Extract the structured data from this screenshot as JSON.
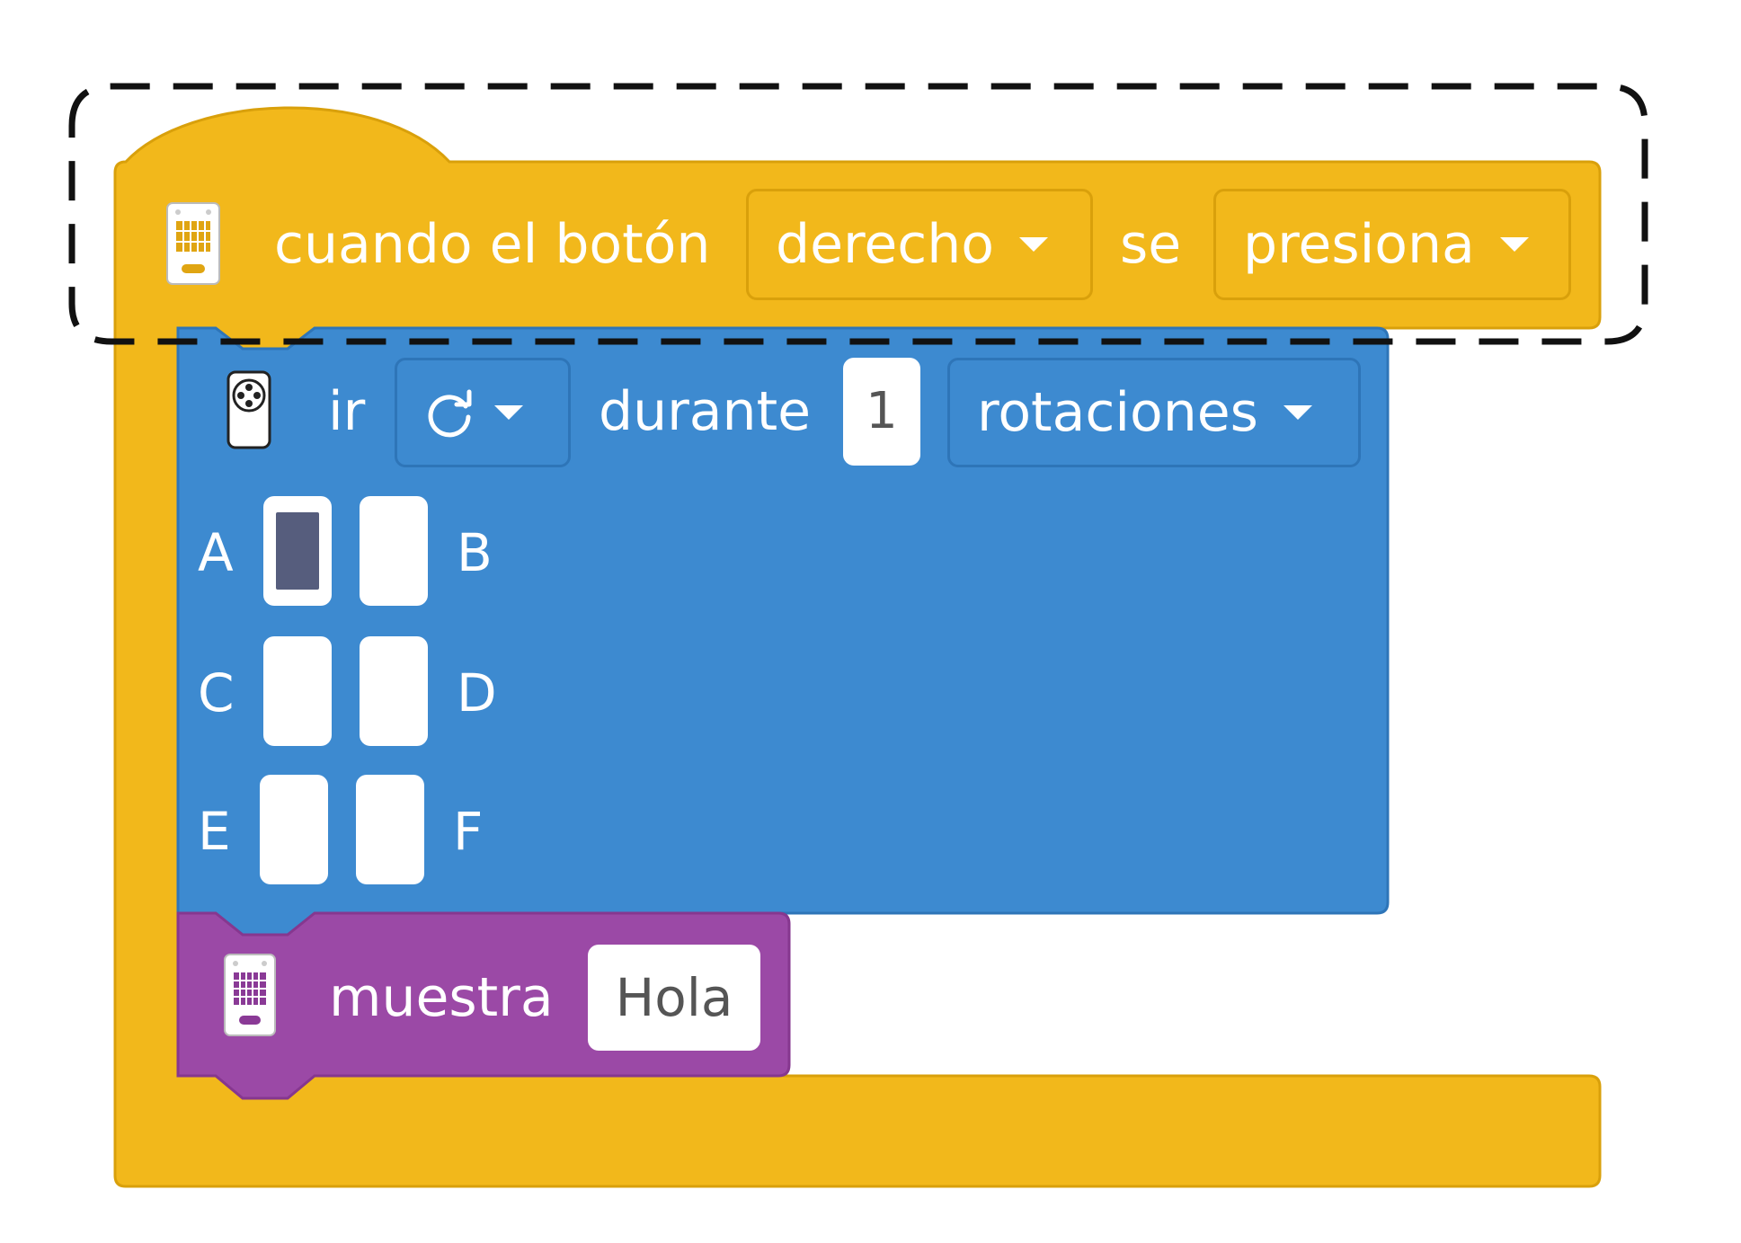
{
  "colors": {
    "event_block": "#f2b81b",
    "motion_block": "#3d8ad0",
    "display_block": "#9b49a6",
    "highlight_dash": "#111111",
    "slot_selected": "#565d7d"
  },
  "event_block": {
    "icon": "microbit-board-icon",
    "label": "cuando el botón",
    "button_select": "derecho",
    "connector": "se",
    "action_select": "presiona"
  },
  "motion_block": {
    "icon": "motor-wheel-icon",
    "label": "ir",
    "direction_icon": "rotate-clockwise-icon",
    "duration_label": "durante",
    "amount": "1",
    "unit_select": "rotaciones",
    "ports": [
      {
        "letter": "A",
        "selected": true
      },
      {
        "letter": "B",
        "selected": false
      },
      {
        "letter": "C",
        "selected": false
      },
      {
        "letter": "D",
        "selected": false
      },
      {
        "letter": "E",
        "selected": false
      },
      {
        "letter": "F",
        "selected": false
      }
    ]
  },
  "display_block": {
    "icon": "microbit-board-icon",
    "label": "muestra",
    "text_value": "Hola"
  }
}
